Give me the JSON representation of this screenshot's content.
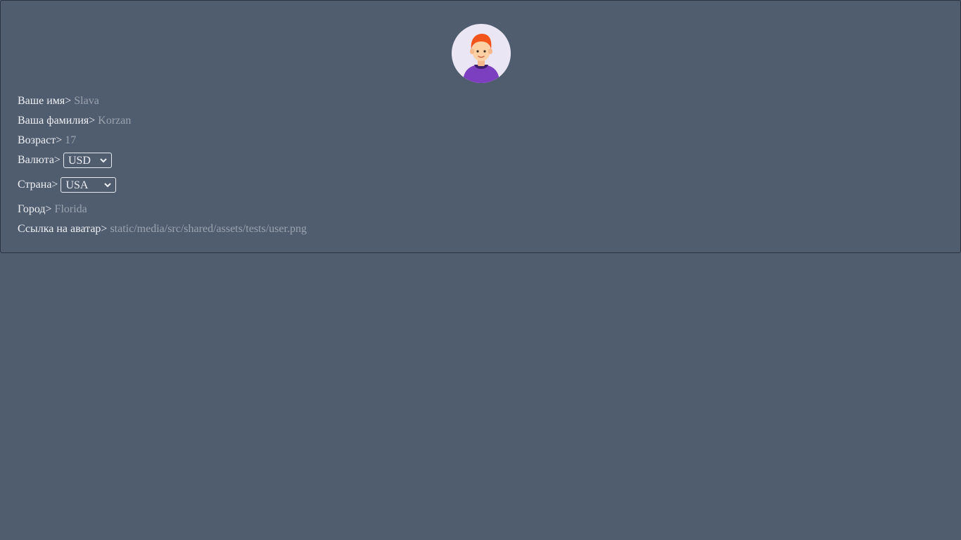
{
  "profile": {
    "first_name_label": "Ваше имя>",
    "first_name_value": "Slava",
    "last_name_label": "Ваша фамилия>",
    "last_name_value": "Korzan",
    "age_label": "Возраст>",
    "age_value": "17",
    "currency_label": "Валюта>",
    "currency_value": "USD",
    "country_label": "Страна>",
    "country_value": "USA",
    "city_label": "Город>",
    "city_value": "Florida",
    "avatar_link_label": "Ссылка на аватар>",
    "avatar_link_value": "static/media/src/shared/assets/tests/user.png"
  },
  "avatar": {
    "icon": "user-avatar-icon"
  },
  "colors": {
    "background": "#505d6f",
    "border": "#2a3240",
    "label_text": "#eef0f3",
    "value_text": "#9ba3ad",
    "avatar_bg": "#ebe6f3",
    "hair": "#f2541b",
    "skin": "#fcd0a5",
    "shirt": "#7b3fbf"
  }
}
